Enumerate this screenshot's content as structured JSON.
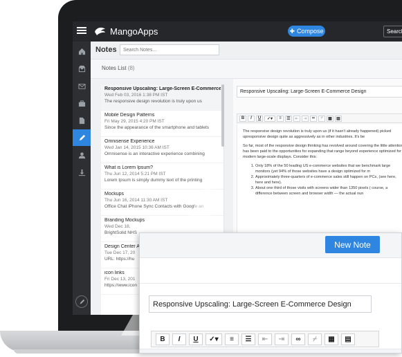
{
  "app": {
    "name": "MangoApps",
    "compose_label": "Compose",
    "search_label": "Search"
  },
  "notes": {
    "title": "Notes",
    "search_placeholder": "Search Notes...",
    "list_title": "Notes List",
    "list_count": "(8)"
  },
  "note_items": [
    {
      "title": "Responsive Upscaling: Large-Screen E-Commerce Design",
      "date": "Wed Feb 03, 2016 1:38 PM IST",
      "snippet": "The responsive design revolution is truly upon us"
    },
    {
      "title": "Mobile Design Patterns",
      "date": "Fri May 29, 2015 4:20 PM IST",
      "snippet": "Since the appearance of the smartphone and tablets"
    },
    {
      "title": "Omnisense Experience",
      "date": "Wed Jan 14, 2015 10:36 AM IST",
      "snippet": "Omnisense is an interactive experience combining"
    },
    {
      "title": "What is Lorem Ipsum?",
      "date": "Thu Jun 12, 2014 5:21 PM IST",
      "snippet": "Lorem Ipsum is simply dummy text of the printing"
    },
    {
      "title": "Mockups",
      "date": "Thu Jun 16, 2014 11:30 AM IST",
      "snippet": "Office Chat iPhone Sync Contacts with Google an"
    },
    {
      "title": "Branding Mockups",
      "date": "Wed Dec 18,",
      "snippet": "BrightSolid NHS"
    },
    {
      "title": "Design Center A",
      "date": "Tue Dec 17, 20",
      "snippet": "URL: https://hu"
    },
    {
      "title": "icon links",
      "date": "Fri Dec 13, 201",
      "snippet": "https://www.icon"
    }
  ],
  "editor": {
    "title_value": "Responsive Upscaling: Large-Screen E-Commerce Design",
    "para1": "The responsive design revolution is truly upon us (if it hasn't already happened) picked upresponsive design quite as aggressively as in other industries. It's be",
    "para2": "So far, most of the responsive design thinking has revolved around covering the little attention has been paid to the opportunities for expanding that range beyond experience optimized for modern large-scale displays. Consider this:",
    "li1": "Only 18% of the 50 leading US e-commerce websites that we benchmark large monitors (yet 94% of those websites have a design optimized for m",
    "li2": "Approximately three-quarters of e-commerce sales still happen on PCs, (see here, here and here).",
    "li3": "About one third of those visits with screens wider than 1350 pixels ( course, a difference between screen and browser width — the actual nun"
  },
  "zoom": {
    "new_note_label": "New Note",
    "title_value": "Responsive Upscaling: Large-Screen E-Commerce Design"
  },
  "toolbar": [
    "B",
    "I",
    "U",
    "spell",
    "ol",
    "ul",
    "outdent",
    "indent",
    "link",
    "unlink",
    "table",
    "paste"
  ],
  "colors": {
    "accent": "#2f86e0",
    "topbar": "#25272b",
    "nav": "#2d2f33"
  },
  "icons": [
    "menu-icon",
    "logo-icon",
    "plus-icon",
    "home-icon",
    "inbox-icon",
    "mail-icon",
    "briefcase-icon",
    "document-icon",
    "pencil-icon",
    "user-icon",
    "download-icon"
  ]
}
